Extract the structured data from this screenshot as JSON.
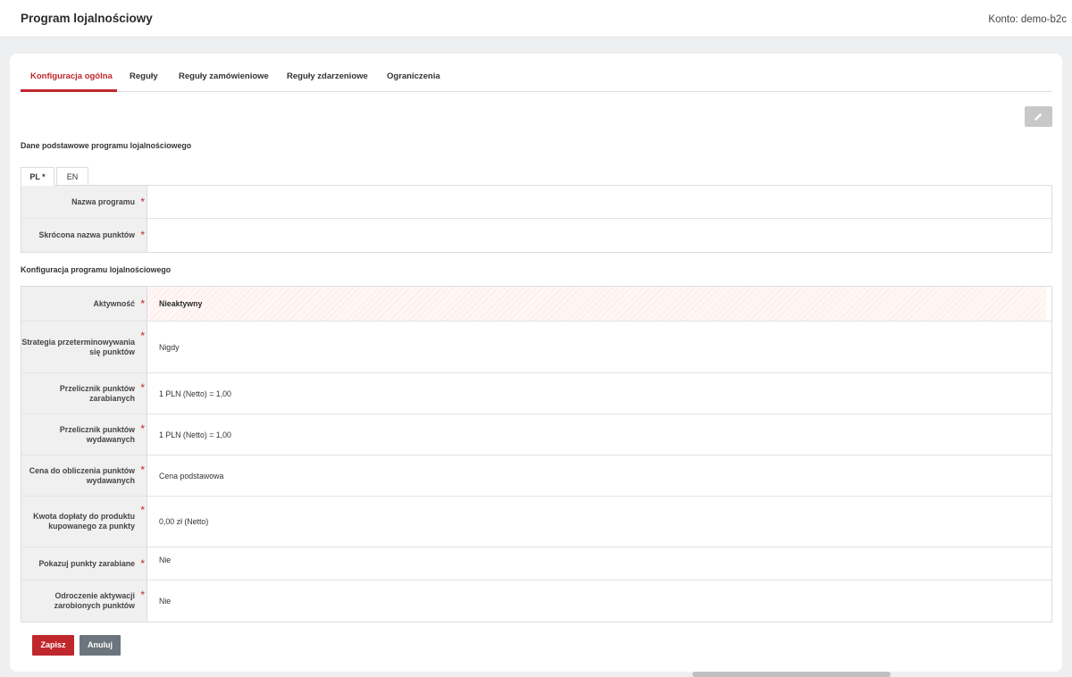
{
  "header": {
    "title": "Program lojalnościowy",
    "account": "Konto: demo-b2c"
  },
  "tabs": [
    {
      "label": "Konfiguracja ogólna",
      "active": true
    },
    {
      "label": "Reguły"
    },
    {
      "label": "Reguły zamówieniowe"
    },
    {
      "label": "Reguły zdarzeniowe"
    },
    {
      "label": "Ograniczenia"
    }
  ],
  "edit_button": {
    "icon": "pencil-icon"
  },
  "basic": {
    "title": "Dane podstawowe programu lojalnościowego",
    "lang_tabs": [
      "PL *",
      "EN"
    ],
    "fields": [
      {
        "label": "Nazwa programu",
        "value": ""
      },
      {
        "label": "Skrócona nazwa punktów",
        "value": ""
      }
    ]
  },
  "config": {
    "title": "Konfiguracja programu lojalnościowego",
    "fields": [
      {
        "label": "Aktywność",
        "value": "Nieaktywny"
      },
      {
        "label": "Strategia przeterminowywania się punktów",
        "value": "Nigdy"
      },
      {
        "label": "Przelicznik punktów zarabianych",
        "value": "1 PLN (Netto) = 1,00"
      },
      {
        "label": "Przelicznik punktów wydawanych",
        "value": "1 PLN (Netto) = 1,00"
      },
      {
        "label": "Cena do obliczenia punktów wydawanych",
        "value": "Cena podstawowa"
      },
      {
        "label": "Kwota dopłaty do produktu kupowanego za punkty",
        "value": "0,00 zł (Netto)"
      },
      {
        "label": "Pokazuj punkty zarabiane",
        "value": "Nie"
      },
      {
        "label": "Odroczenie aktywacji zarobionych punktów",
        "value": "Nie"
      }
    ]
  },
  "required_mark": "*",
  "actions": {
    "save": "Zapisz",
    "cancel": "Anuluj"
  },
  "colors": {
    "accent": "#c0272d",
    "cancel": "#6c757d"
  }
}
